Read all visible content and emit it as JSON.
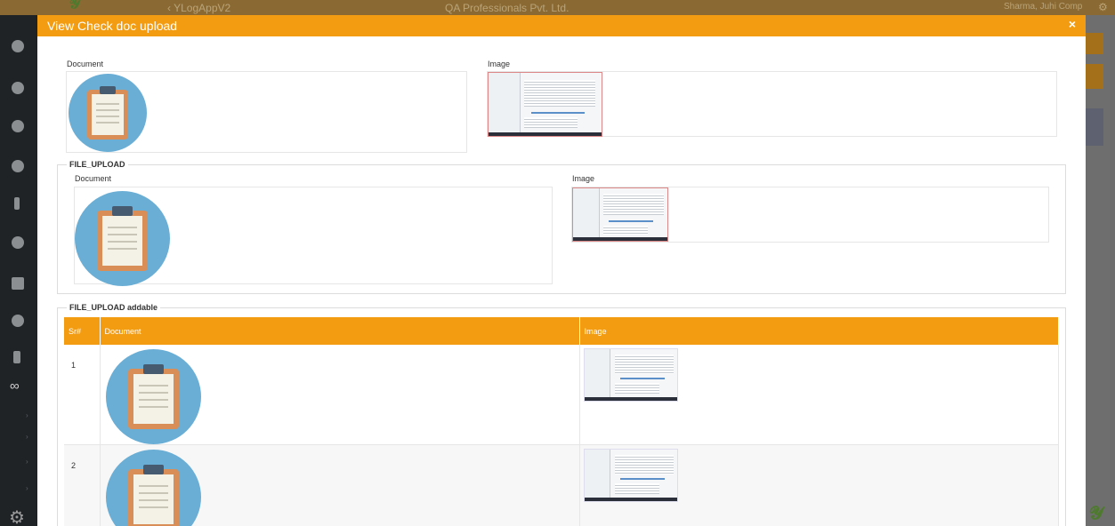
{
  "app": {
    "back_label": "‹ YLogAppV2",
    "company": "QA Professionals Pvt. Ltd.",
    "user": "Sharma, Juhi Comp"
  },
  "modal": {
    "title": "View Check doc upload",
    "close": "×",
    "top": {
      "document_label": "Document",
      "image_label": "Image"
    },
    "file_upload": {
      "legend": "FILE_UPLOAD",
      "document_label": "Document",
      "image_label": "Image"
    },
    "file_upload_addable": {
      "legend": "FILE_UPLOAD addable",
      "columns": [
        "Sr#",
        "Document",
        "Image"
      ],
      "rows": [
        {
          "sr": "1"
        },
        {
          "sr": "2"
        }
      ]
    }
  },
  "colors": {
    "accent": "#f39c12",
    "icon_circle": "#6aaed6",
    "clipboard": "#d98e57"
  },
  "icons": {
    "document": "clipboard-icon",
    "image": "screenshot-thumbnail",
    "close": "close-icon"
  }
}
